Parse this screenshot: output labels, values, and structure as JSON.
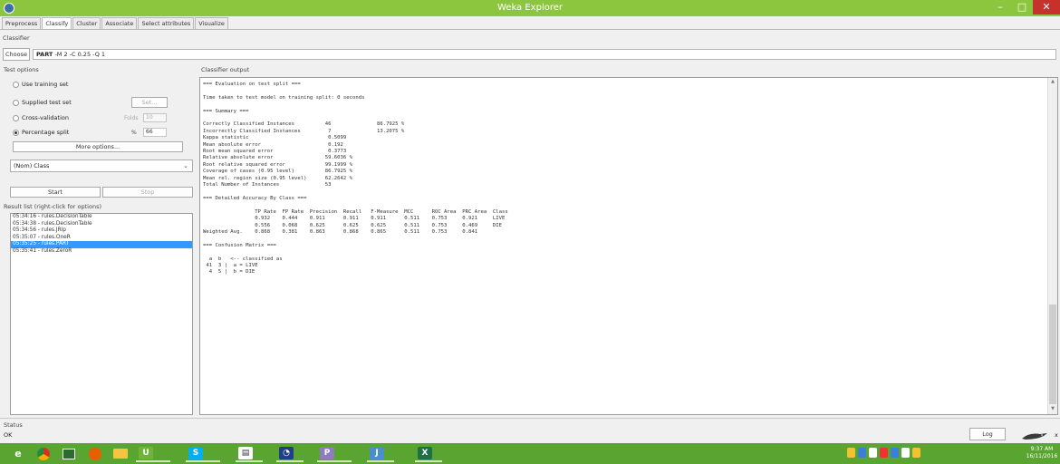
{
  "window": {
    "title": "Weka Explorer",
    "min": "–",
    "max": "□",
    "close": "✕"
  },
  "tabs": [
    "Preprocess",
    "Classify",
    "Cluster",
    "Associate",
    "Select attributes",
    "Visualize"
  ],
  "classifier": {
    "section_label": "Classifier",
    "choose_label": "Choose",
    "name": "PART",
    "options": "-M 2 -C 0.25 -Q 1"
  },
  "test_options": {
    "label": "Test options",
    "use_training": "Use training set",
    "supplied": "Supplied test set",
    "set_button": "Set...",
    "cross_validation": "Cross-validation",
    "folds_label": "Folds",
    "folds_value": "10",
    "percentage_split": "Percentage split",
    "percent_label": "%",
    "percent_value": "66",
    "selected": "percentage_split",
    "more_options": "More options..."
  },
  "class_select": {
    "value": "(Nom) Class"
  },
  "actions": {
    "start": "Start",
    "stop": "Stop"
  },
  "result_list": {
    "label": "Result list (right-click for options)",
    "items": [
      "05:34:16 - rules.DecisionTable",
      "05:34:38 - rules.DecisionTable",
      "05:34:56 - rules.JRip",
      "05:35:07 - rules.OneR",
      "05:35:25 - rules.PART",
      "05:35:41 - rules.ZeroR"
    ],
    "selected_index": 4
  },
  "output": {
    "label": "Classifier output",
    "text": "=== Evaluation on test split ===\n\nTime taken to test model on training split: 0 seconds\n\n=== Summary ===\n\nCorrectly Classified Instances          46               86.7925 %\nIncorrectly Classified Instances         7               13.2075 %\nKappa statistic                          0.5099\nMean absolute error                      0.192\nRoot mean squared error                  0.3773\nRelative absolute error                 59.6036 %\nRoot relative squared error             99.1999 %\nCoverage of cases (0.95 level)          86.7925 %\nMean rel. region size (0.95 level)      62.2642 %\nTotal Number of Instances               53\n\n=== Detailed Accuracy By Class ===\n\n                 TP Rate  FP Rate  Precision  Recall   F-Measure  MCC      ROC Area  PRC Area  Class\n                 0.932    0.444    0.911      0.911    0.911      0.511    0.753     0.921     LIVE\n                 0.556    0.068    0.625      0.625    0.625      0.511    0.753     0.469     DIE\nWeighted Avg.    0.868    0.381    0.863      0.868    0.865      0.511    0.753     0.841\n\n=== Confusion Matrix ===\n\n  a  b   <-- classified as\n 41  3 |  a = LIVE\n  4  5 |  b = DIE"
  },
  "status": {
    "label": "Status",
    "value": "OK",
    "log_button": "Log",
    "x_label": "x 0"
  },
  "taskbar": {
    "time": "9:37 AM",
    "date": "16/11/2016"
  }
}
